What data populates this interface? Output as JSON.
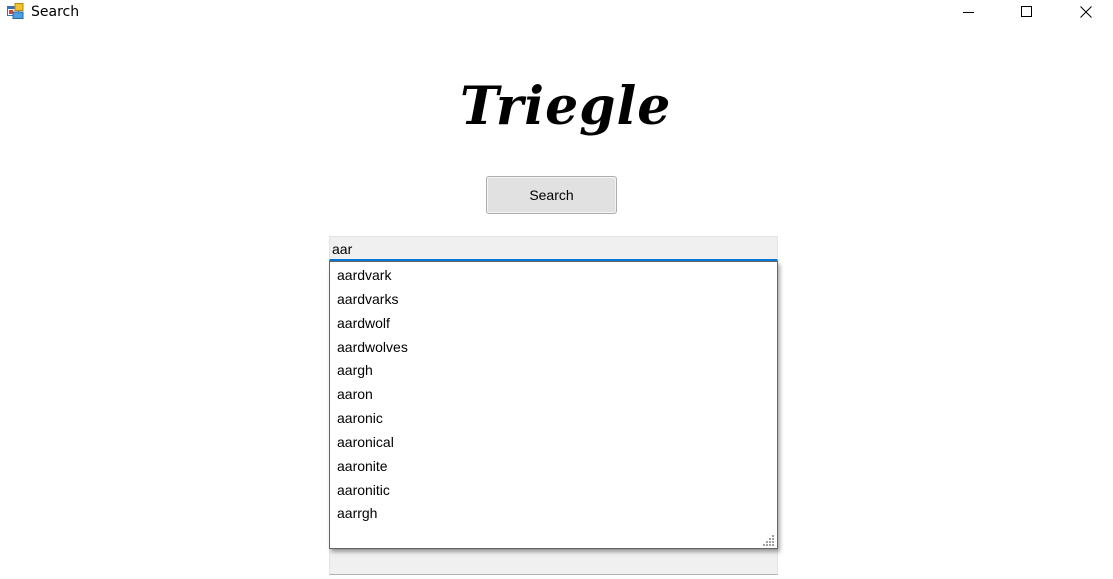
{
  "window": {
    "title": "Search",
    "icon": "app-window-icon",
    "controls": {
      "minimize_icon": "minimize-icon",
      "maximize_icon": "maximize-icon",
      "close_icon": "close-icon"
    }
  },
  "logo": {
    "text": "Triegle"
  },
  "search_button": {
    "label": "Search"
  },
  "search_input": {
    "value": "aar"
  },
  "suggestions": [
    "aardvark",
    "aardvarks",
    "aardwolf",
    "aardwolves",
    "aargh",
    "aaron",
    "aaronic",
    "aaronical",
    "aaronite",
    "aaronitic",
    "aarrgh"
  ],
  "colors": {
    "input_focus_border": "#0078d7",
    "button_background": "#e1e1e1",
    "input_background": "#f0f0f0"
  }
}
